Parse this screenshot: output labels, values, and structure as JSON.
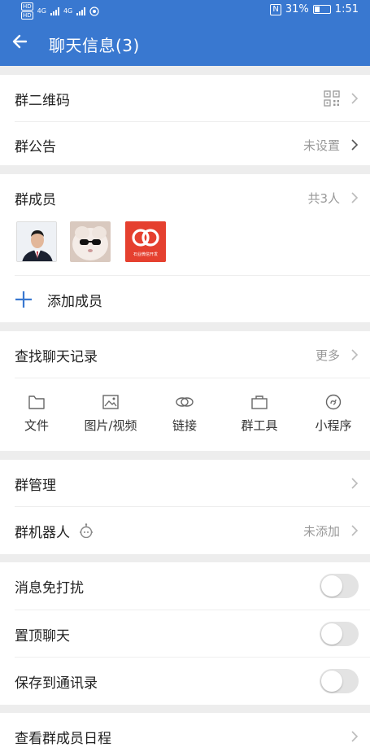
{
  "status_bar": {
    "left_labels": [
      "HD",
      "HD",
      "4G",
      "4G"
    ],
    "nfc": "N",
    "battery": "31%",
    "time": "1:51"
  },
  "header": {
    "title": "聊天信息(3)",
    "back_icon": "back-arrow-icon"
  },
  "sections": {
    "qr": {
      "label": "群二维码",
      "icon": "qr-code-icon"
    },
    "notice": {
      "label": "群公告",
      "value": "未设置"
    },
    "members": {
      "label": "群成员",
      "count": "共3人",
      "avatars": [
        {
          "name": "member-1",
          "avatar_text": ""
        },
        {
          "name": "member-2",
          "avatar_text": ""
        },
        {
          "name": "member-3",
          "avatar_text": "石业微信开发"
        }
      ]
    },
    "add_member": {
      "label": "添加成员"
    },
    "search": {
      "label": "查找聊天记录",
      "value": "更多"
    },
    "tools": [
      {
        "label": "文件",
        "icon": "folder-icon"
      },
      {
        "label": "图片/视频",
        "icon": "image-icon"
      },
      {
        "label": "链接",
        "icon": "link-icon"
      },
      {
        "label": "群工具",
        "icon": "toolbox-icon"
      },
      {
        "label": "小程序",
        "icon": "mini-program-icon"
      }
    ],
    "manage": {
      "label": "群管理"
    },
    "robot": {
      "label": "群机器人",
      "value": "未添加",
      "icon": "robot-icon"
    },
    "toggles": [
      {
        "label": "消息免打扰",
        "on": false
      },
      {
        "label": "置顶聊天",
        "on": false
      },
      {
        "label": "保存到通讯录",
        "on": false
      }
    ],
    "schedule": {
      "label": "查看群成员日程"
    }
  },
  "colors": {
    "header_bg": "#3978d0",
    "accent_blue": "#3978d0",
    "toggle_off": "#e3e3e3",
    "page_bg": "#ededed"
  }
}
